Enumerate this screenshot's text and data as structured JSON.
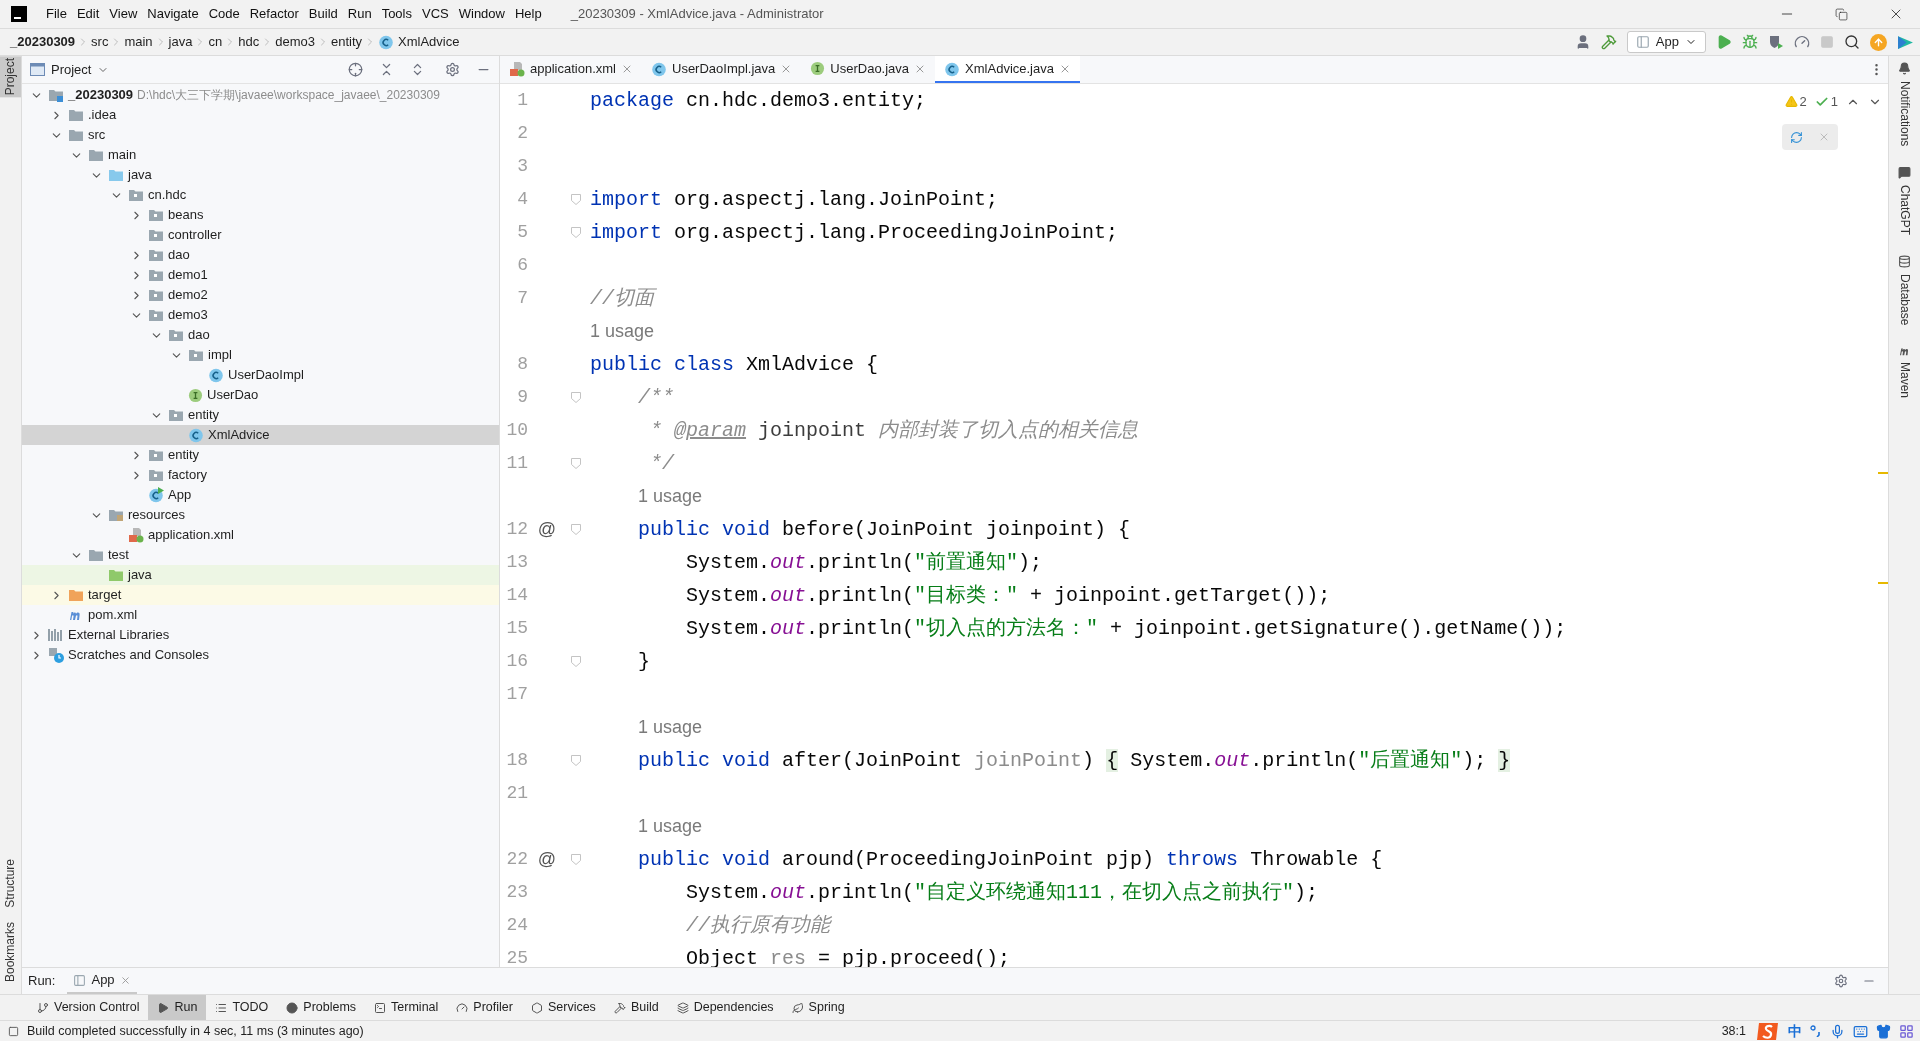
{
  "window": {
    "title": "_20230309 - XmlAdvice.java - Administrator"
  },
  "menu": [
    "File",
    "Edit",
    "View",
    "Navigate",
    "Code",
    "Refactor",
    "Build",
    "Run",
    "Tools",
    "VCS",
    "Window",
    "Help"
  ],
  "breadcrumbs": [
    "_20230309",
    "src",
    "main",
    "java",
    "cn",
    "hdc",
    "demo3",
    "entity",
    "XmlAdvice"
  ],
  "run_config": {
    "label": "App"
  },
  "left_tools_top": [
    {
      "label": "Project",
      "selected": true
    }
  ],
  "left_tools_bottom": [
    {
      "label": "Structure",
      "selected": false
    },
    {
      "label": "Bookmarks",
      "selected": false
    }
  ],
  "project_panel": {
    "title": "Project",
    "tree": [
      {
        "label": "_20230309",
        "path": "D:\\hdc\\大三下学期\\javaee\\workspace_javaee\\_20230309",
        "kind": "module",
        "expanded": true,
        "selected": false,
        "children": [
          {
            "label": ".idea",
            "kind": "folder",
            "expanded": false,
            "selected": false
          },
          {
            "label": "src",
            "kind": "folder",
            "expanded": true,
            "selected": false,
            "children": [
              {
                "label": "main",
                "kind": "folder",
                "expanded": true,
                "selected": false,
                "children": [
                  {
                    "label": "java",
                    "kind": "source",
                    "expanded": true,
                    "selected": false,
                    "children": [
                      {
                        "label": "cn.hdc",
                        "kind": "package",
                        "expanded": true,
                        "selected": false,
                        "children": [
                          {
                            "label": "beans",
                            "kind": "package",
                            "expanded": false,
                            "selected": false
                          },
                          {
                            "label": "controller",
                            "kind": "package",
                            "selected": false
                          },
                          {
                            "label": "dao",
                            "kind": "package",
                            "expanded": false,
                            "selected": false
                          },
                          {
                            "label": "demo1",
                            "kind": "package",
                            "expanded": false,
                            "selected": false
                          },
                          {
                            "label": "demo2",
                            "kind": "package",
                            "expanded": false,
                            "selected": false
                          },
                          {
                            "label": "demo3",
                            "kind": "package",
                            "expanded": true,
                            "selected": false,
                            "children": [
                              {
                                "label": "dao",
                                "kind": "package",
                                "expanded": true,
                                "selected": false,
                                "children": [
                                  {
                                    "label": "impl",
                                    "kind": "package",
                                    "expanded": true,
                                    "selected": false,
                                    "children": [
                                      {
                                        "label": "UserDaoImpl",
                                        "kind": "class",
                                        "selected": false
                                      }
                                    ]
                                  },
                                  {
                                    "label": "UserDao",
                                    "kind": "interface",
                                    "selected": false
                                  }
                                ]
                              },
                              {
                                "label": "entity",
                                "kind": "package",
                                "expanded": true,
                                "selected": false,
                                "children": [
                                  {
                                    "label": "XmlAdvice",
                                    "kind": "class",
                                    "selected": true
                                  }
                                ]
                              }
                            ]
                          },
                          {
                            "label": "entity",
                            "kind": "package",
                            "expanded": false,
                            "selected": false
                          },
                          {
                            "label": "factory",
                            "kind": "package",
                            "expanded": false,
                            "selected": false
                          },
                          {
                            "label": "App",
                            "kind": "run-class",
                            "selected": false
                          }
                        ]
                      }
                    ]
                  },
                  {
                    "label": "resources",
                    "kind": "resources",
                    "expanded": true,
                    "selected": false,
                    "children": [
                      {
                        "label": "application.xml",
                        "kind": "xml",
                        "selected": false
                      }
                    ]
                  }
                ]
              },
              {
                "label": "test",
                "kind": "folder",
                "expanded": true,
                "selected": false,
                "children": [
                  {
                    "label": "java",
                    "kind": "test-source",
                    "selected": false,
                    "color": "#edf6e4"
                  }
                ]
              }
            ]
          },
          {
            "label": "target",
            "kind": "excluded",
            "expanded": false,
            "selected": false,
            "color": "#fcfae6"
          },
          {
            "label": "pom.xml",
            "kind": "maven",
            "selected": false
          }
        ]
      },
      {
        "label": "External Libraries",
        "kind": "libraries",
        "expanded": false,
        "selected": false
      },
      {
        "label": "Scratches and Consoles",
        "kind": "scratches",
        "expanded": false,
        "selected": false
      }
    ]
  },
  "editor_tabs": [
    {
      "label": "application.xml",
      "kind": "xml",
      "selected": false
    },
    {
      "label": "UserDaoImpl.java",
      "kind": "class",
      "selected": false
    },
    {
      "label": "UserDao.java",
      "kind": "interface",
      "selected": false
    },
    {
      "label": "XmlAdvice.java",
      "kind": "class",
      "selected": true
    }
  ],
  "inspection": {
    "warnings": "2",
    "typos": "1"
  },
  "editor_lines": [
    {
      "kind": "code",
      "number": "1",
      "tokens": [
        {
          "kind": "keyword",
          "text": "package"
        },
        {
          "kind": "plain",
          "text": " cn.hdc.demo3.entity;"
        }
      ]
    },
    {
      "kind": "code",
      "number": "2"
    },
    {
      "kind": "code",
      "number": "3"
    },
    {
      "kind": "code",
      "number": "4",
      "fold": true,
      "tokens": [
        {
          "kind": "keyword",
          "text": "import"
        },
        {
          "kind": "plain",
          "text": " org.aspectj.lang.JoinPoint;"
        }
      ]
    },
    {
      "kind": "code",
      "number": "5",
      "fold": true,
      "tokens": [
        {
          "kind": "keyword",
          "text": "import"
        },
        {
          "kind": "plain",
          "text": " org.aspectj.lang.ProceedingJoinPoint;"
        }
      ]
    },
    {
      "kind": "code",
      "number": "6"
    },
    {
      "kind": "code",
      "number": "7",
      "tokens": [
        {
          "kind": "comment",
          "text": "//切面"
        }
      ]
    },
    {
      "kind": "usage",
      "text": "1 usage"
    },
    {
      "kind": "code",
      "number": "8",
      "tokens": [
        {
          "kind": "keyword",
          "text": "public class"
        },
        {
          "kind": "plain",
          "text": " XmlAdvice {"
        }
      ]
    },
    {
      "kind": "code",
      "number": "9",
      "fold": true,
      "tokens": [
        {
          "kind": "doc",
          "text": "    /**"
        }
      ]
    },
    {
      "kind": "code",
      "number": "10",
      "tokens": [
        {
          "kind": "doc",
          "text": "     * "
        },
        {
          "kind": "doctag",
          "text": "@param"
        },
        {
          "kind": "docparam",
          "text": " joinpoint"
        },
        {
          "kind": "doc",
          "text": " 内部封装了切入点的相关信息"
        }
      ]
    },
    {
      "kind": "code",
      "number": "11",
      "fold": true,
      "tokens": [
        {
          "kind": "doc",
          "text": "     */"
        }
      ]
    },
    {
      "kind": "usage",
      "text": "1 usage"
    },
    {
      "kind": "code",
      "number": "12",
      "gutter": "@",
      "fold": true,
      "tokens": [
        {
          "kind": "keyword",
          "text": "    public void"
        },
        {
          "kind": "plain",
          "text": " before(JoinPoint joinpoint) {"
        }
      ]
    },
    {
      "kind": "code",
      "number": "13",
      "tokens": [
        {
          "kind": "plain",
          "text": "        System."
        },
        {
          "kind": "field",
          "text": "out"
        },
        {
          "kind": "plain",
          "text": ".println("
        },
        {
          "kind": "string",
          "text": "\"前置通知\""
        },
        {
          "kind": "plain",
          "text": ");"
        }
      ]
    },
    {
      "kind": "code",
      "number": "14",
      "tokens": [
        {
          "kind": "plain",
          "text": "        System."
        },
        {
          "kind": "field",
          "text": "out"
        },
        {
          "kind": "plain",
          "text": ".println("
        },
        {
          "kind": "string",
          "text": "\"目标类：\""
        },
        {
          "kind": "plain",
          "text": " + joinpoint.getTarget());"
        }
      ]
    },
    {
      "kind": "code",
      "number": "15",
      "tokens": [
        {
          "kind": "plain",
          "text": "        System."
        },
        {
          "kind": "field",
          "text": "out"
        },
        {
          "kind": "plain",
          "text": ".println("
        },
        {
          "kind": "string",
          "text": "\"切入点的方法名：\""
        },
        {
          "kind": "plain",
          "text": " + joinpoint.getSignature().getName());"
        }
      ]
    },
    {
      "kind": "code",
      "number": "16",
      "fold": true,
      "tokens": [
        {
          "kind": "plain",
          "text": "    }"
        }
      ]
    },
    {
      "kind": "code",
      "number": "17"
    },
    {
      "kind": "usage",
      "text": "1 usage"
    },
    {
      "kind": "code",
      "number": "18",
      "fold": true,
      "tokens": [
        {
          "kind": "keyword",
          "text": "    public void"
        },
        {
          "kind": "plain",
          "text": " after(JoinPoint "
        },
        {
          "kind": "unused",
          "text": "joinPoint"
        },
        {
          "kind": "plain",
          "text": ") "
        },
        {
          "kind": "folded",
          "text": "{"
        },
        {
          "kind": "plain",
          "text": " System."
        },
        {
          "kind": "field",
          "text": "out"
        },
        {
          "kind": "plain",
          "text": ".println("
        },
        {
          "kind": "string",
          "text": "\"后置通知\""
        },
        {
          "kind": "plain",
          "text": "); "
        },
        {
          "kind": "folded",
          "text": "}"
        }
      ]
    },
    {
      "kind": "code",
      "number": "21"
    },
    {
      "kind": "usage",
      "text": "1 usage"
    },
    {
      "kind": "code",
      "number": "22",
      "gutter": "@",
      "fold": true,
      "tokens": [
        {
          "kind": "keyword",
          "text": "    public void"
        },
        {
          "kind": "plain",
          "text": " around(ProceedingJoinPoint pjp) "
        },
        {
          "kind": "keyword",
          "text": "throws"
        },
        {
          "kind": "plain",
          "text": " Throwable {"
        }
      ]
    },
    {
      "kind": "code",
      "number": "23",
      "tokens": [
        {
          "kind": "plain",
          "text": "        System."
        },
        {
          "kind": "field",
          "text": "out"
        },
        {
          "kind": "plain",
          "text": ".println("
        },
        {
          "kind": "string",
          "text": "\"自定义环绕通知111，在切入点之前执行\""
        },
        {
          "kind": "plain",
          "text": ");"
        }
      ]
    },
    {
      "kind": "code",
      "number": "24",
      "tokens": [
        {
          "kind": "comment",
          "text": "        //执行原有功能"
        }
      ]
    },
    {
      "kind": "code",
      "number": "25",
      "tokens": [
        {
          "kind": "plain",
          "text": "        Object "
        },
        {
          "kind": "unused",
          "text": "res"
        },
        {
          "kind": "plain",
          "text": " = pjp.proceed();"
        }
      ]
    }
  ],
  "right_tools": [
    {
      "label": "Notifications",
      "kind": "bell"
    },
    {
      "label": "ChatGPT",
      "kind": "chat"
    },
    {
      "label": "Database",
      "kind": "database"
    },
    {
      "label": "Maven",
      "kind": "maven"
    }
  ],
  "run_panel": {
    "label": "Run:",
    "tabs": [
      {
        "label": "App",
        "selected": true
      }
    ]
  },
  "bottom_tabs": [
    {
      "label": "Version Control",
      "kind": "vcs",
      "selected": false
    },
    {
      "label": "Run",
      "kind": "run",
      "selected": true
    },
    {
      "label": "TODO",
      "kind": "todo",
      "selected": false
    },
    {
      "label": "Problems",
      "kind": "problems",
      "selected": false
    },
    {
      "label": "Terminal",
      "kind": "terminal",
      "selected": false
    },
    {
      "label": "Profiler",
      "kind": "profiler",
      "selected": false
    },
    {
      "label": "Services",
      "kind": "services",
      "selected": false
    },
    {
      "label": "Build",
      "kind": "build",
      "selected": false
    },
    {
      "label": "Dependencies",
      "kind": "dependencies",
      "selected": false
    },
    {
      "label": "Spring",
      "kind": "spring",
      "selected": false
    }
  ],
  "status_bar": {
    "message": "Build completed successfully in 4 sec, 11 ms (3 minutes ago)",
    "caret": "38:1",
    "ime": "中"
  }
}
